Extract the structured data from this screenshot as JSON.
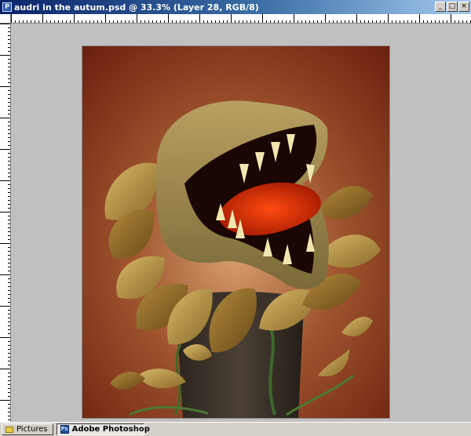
{
  "window": {
    "title": "audri in the autum.psd @ 33.3% (Layer 28, RGB/8)",
    "controls": {
      "minimize": "_",
      "maximize": "□",
      "close": "×"
    }
  },
  "canvas": {
    "background_top": "#6a1e0e",
    "background_mid": "#a0552e",
    "background_bottom": "#d8a070"
  },
  "taskbar": {
    "items": [
      {
        "label": "Pictures",
        "icon": "folder-icon",
        "active": false
      },
      {
        "label": "Adobe Photoshop",
        "icon": "photoshop-icon",
        "active": true
      }
    ]
  },
  "colors": {
    "titlebar_start": "#0a246a",
    "titlebar_end": "#a6caf0",
    "chrome": "#d4d0c8",
    "workspace": "#c0c0c0"
  }
}
